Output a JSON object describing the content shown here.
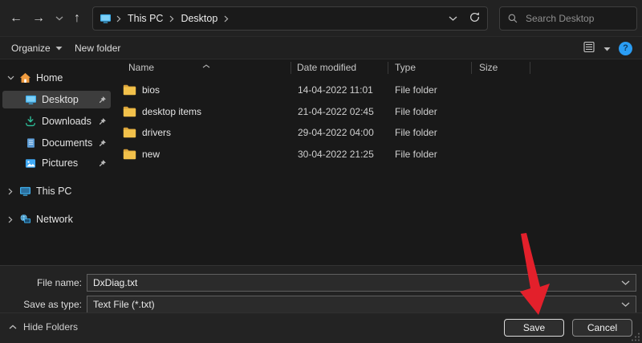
{
  "toolbar": {
    "nav_icons": {
      "back": "←",
      "forward": "→",
      "up": "↑"
    },
    "breadcrumb": {
      "icon": "this-pc-icon",
      "items": [
        "This PC",
        "Desktop"
      ]
    },
    "search": {
      "placeholder": "Search Desktop",
      "icon": "search-icon"
    }
  },
  "command_bar": {
    "organize_label": "Organize",
    "new_folder_label": "New folder",
    "right_icons": [
      "details-view-icon",
      "view-dropdown-icon",
      "help-icon"
    ]
  },
  "sidebar": {
    "items": [
      {
        "label": "Home",
        "icon": "home-icon",
        "expanded": true,
        "pinned": false,
        "selected": false
      },
      {
        "label": "Desktop",
        "icon": "desktop-icon",
        "expanded": false,
        "pinned": true,
        "selected": true
      },
      {
        "label": "Downloads",
        "icon": "downloads-icon",
        "expanded": false,
        "pinned": true,
        "selected": false
      },
      {
        "label": "Documents",
        "icon": "documents-icon",
        "expanded": false,
        "pinned": true,
        "selected": false
      },
      {
        "label": "Pictures",
        "icon": "pictures-icon",
        "expanded": false,
        "pinned": true,
        "selected": false
      },
      {
        "label": "This PC",
        "icon": "this-pc-icon",
        "expanded": false,
        "pinned": false,
        "selected": false
      },
      {
        "label": "Network",
        "icon": "network-icon",
        "expanded": false,
        "pinned": false,
        "selected": false
      }
    ]
  },
  "file_list": {
    "columns": [
      "Name",
      "Date modified",
      "Type",
      "Size"
    ],
    "sort": {
      "column": "Name",
      "direction": "ascending"
    },
    "rows": [
      {
        "name": "bios",
        "date_modified": "14-04-2022 11:01",
        "type": "File folder",
        "size": ""
      },
      {
        "name": "desktop items",
        "date_modified": "21-04-2022 02:45",
        "type": "File folder",
        "size": ""
      },
      {
        "name": "drivers",
        "date_modified": "29-04-2022 04:00",
        "type": "File folder",
        "size": ""
      },
      {
        "name": "new",
        "date_modified": "30-04-2022 21:25",
        "type": "File folder",
        "size": ""
      }
    ]
  },
  "footer": {
    "file_name_label": "File name:",
    "file_name_value": "DxDiag.txt",
    "save_as_type_label": "Save as type:",
    "save_as_type_value": "Text File (*.txt)",
    "hide_folders_label": "Hide Folders",
    "save_label": "Save",
    "cancel_label": "Cancel"
  },
  "annotation": {
    "shape": "red-arrow",
    "points_to": "save-button",
    "color": "#e3202b"
  },
  "colors": {
    "accent_blue": "#3fb0ee",
    "folder_yellow": "#f2c14b",
    "downloads_green": "#2dbf9a",
    "home_orange": "#ef9b3f",
    "help_blue": "#2a9df4",
    "selection_gray": "#3d3d3d",
    "arrow_red": "#e3202b"
  }
}
